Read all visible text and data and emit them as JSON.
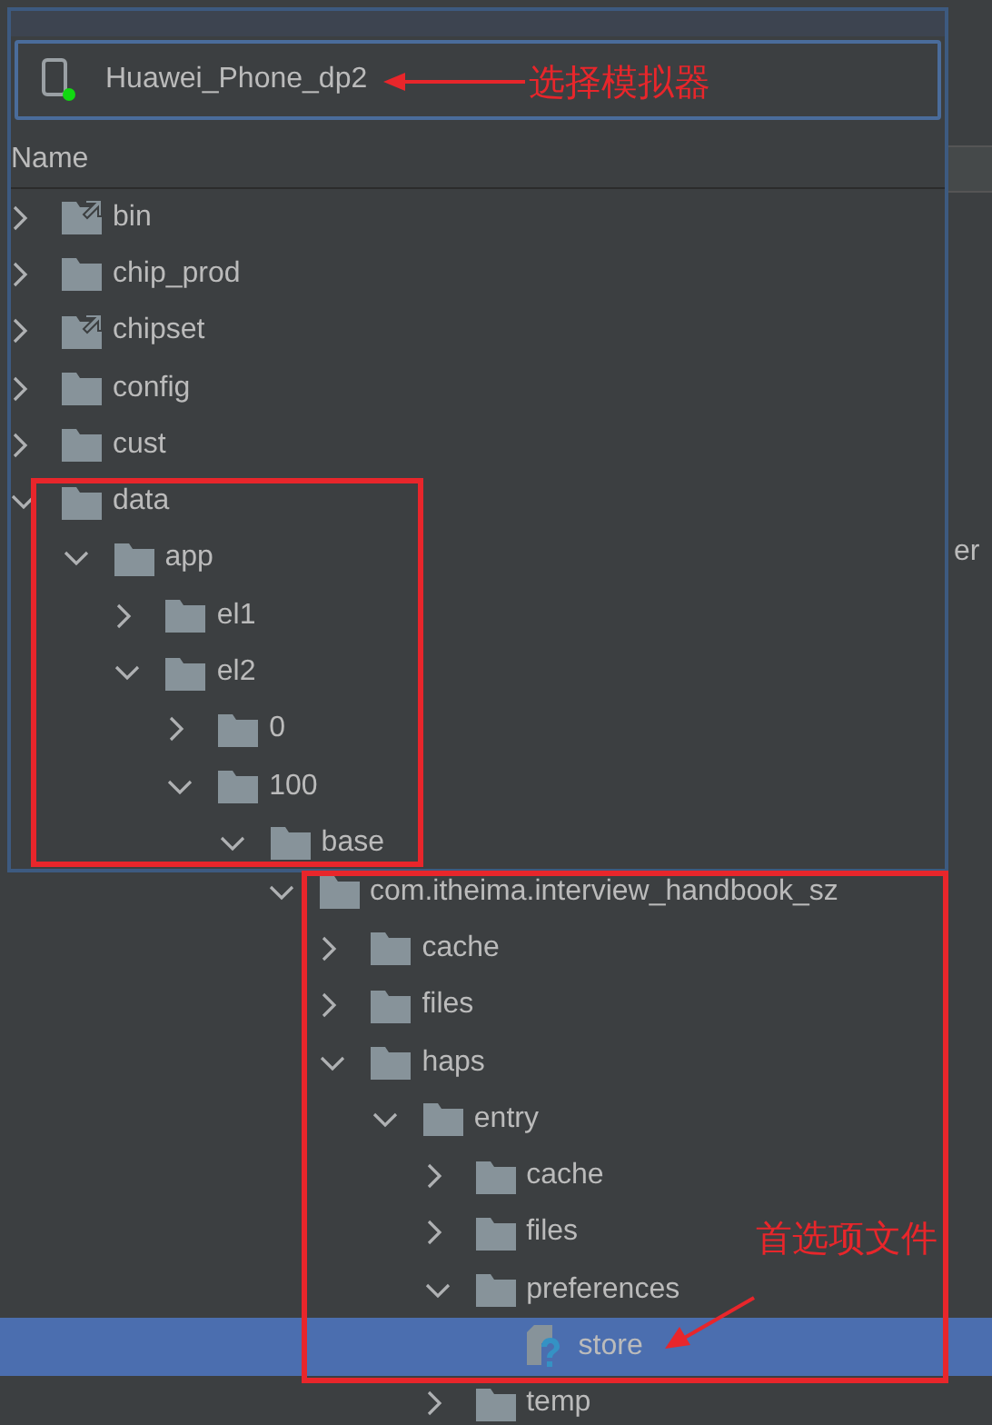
{
  "device": {
    "name": "Huawei_Phone_dp2",
    "connected": true
  },
  "column": "Name",
  "tree": [
    {
      "name": "bin",
      "kind": "folder_link",
      "expanded": false,
      "selected": false,
      "in_popup": true
    },
    {
      "name": "chip_prod",
      "kind": "folder",
      "expanded": false,
      "selected": false,
      "in_popup": true
    },
    {
      "name": "chipset",
      "kind": "folder_link",
      "expanded": false,
      "selected": false,
      "in_popup": true
    },
    {
      "name": "config",
      "kind": "folder",
      "expanded": false,
      "selected": false,
      "in_popup": true
    },
    {
      "name": "cust",
      "kind": "folder",
      "expanded": false,
      "selected": false,
      "in_popup": true
    },
    {
      "name": "data",
      "kind": "folder",
      "expanded": true,
      "selected": false,
      "in_popup": true,
      "children": [
        {
          "name": "app",
          "kind": "folder",
          "expanded": true,
          "selected": false,
          "in_popup": true,
          "children": [
            {
              "name": "el1",
              "kind": "folder",
              "expanded": false,
              "selected": false,
              "in_popup": true
            },
            {
              "name": "el2",
              "kind": "folder",
              "expanded": true,
              "selected": false,
              "in_popup": true,
              "children": [
                {
                  "name": "0",
                  "kind": "folder",
                  "expanded": false,
                  "selected": false,
                  "in_popup": true
                },
                {
                  "name": "100",
                  "kind": "folder",
                  "expanded": true,
                  "selected": false,
                  "in_popup": true,
                  "children": [
                    {
                      "name": "base",
                      "kind": "folder",
                      "expanded": true,
                      "selected": false,
                      "in_popup": true,
                      "children": [
                        {
                          "name": "com.itheima.interview_handbook_sz",
                          "kind": "folder",
                          "expanded": true,
                          "selected": false,
                          "in_popup": false,
                          "children": [
                            {
                              "name": "cache",
                              "kind": "folder",
                              "expanded": false,
                              "selected": false,
                              "in_popup": false
                            },
                            {
                              "name": "files",
                              "kind": "folder",
                              "expanded": false,
                              "selected": false,
                              "in_popup": false
                            },
                            {
                              "name": "haps",
                              "kind": "folder",
                              "expanded": true,
                              "selected": false,
                              "in_popup": false,
                              "children": [
                                {
                                  "name": "entry",
                                  "kind": "folder",
                                  "expanded": true,
                                  "selected": false,
                                  "in_popup": false,
                                  "children": [
                                    {
                                      "name": "cache",
                                      "kind": "folder",
                                      "expanded": false,
                                      "selected": false,
                                      "in_popup": false
                                    },
                                    {
                                      "name": "files",
                                      "kind": "folder",
                                      "expanded": false,
                                      "selected": false,
                                      "in_popup": false
                                    },
                                    {
                                      "name": "preferences",
                                      "kind": "folder",
                                      "expanded": true,
                                      "selected": false,
                                      "in_popup": false,
                                      "children": [
                                        {
                                          "name": "store",
                                          "kind": "file",
                                          "selected": true,
                                          "in_popup": false
                                        }
                                      ]
                                    },
                                    {
                                      "name": "temp",
                                      "kind": "folder",
                                      "expanded": false,
                                      "selected": false,
                                      "in_popup": false
                                    }
                                  ]
                                }
                              ]
                            }
                          ]
                        }
                      ]
                    }
                  ]
                }
              ]
            }
          ]
        }
      ]
    }
  ],
  "background_text": "er",
  "annotations": [
    {
      "kind": "device_label",
      "text": "选择模拟器"
    },
    {
      "kind": "file_label",
      "text": "首选项文件"
    }
  ]
}
